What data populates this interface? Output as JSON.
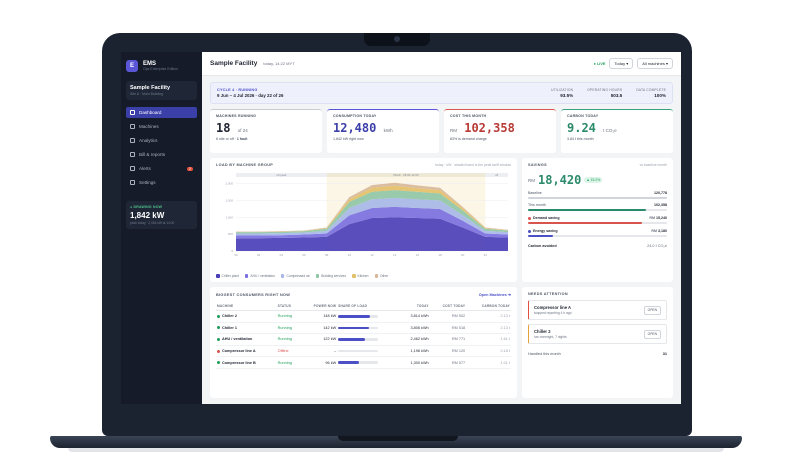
{
  "app": {
    "logo": "E",
    "name": "EMS",
    "subtitle": "Ops Enterprise Edition"
  },
  "facility": {
    "name": "Sample Facility",
    "sub": "Site A · Main Building"
  },
  "nav": [
    {
      "label": "Dashboard",
      "icon": "dashboard-icon"
    },
    {
      "label": "Machines",
      "icon": "machines-icon"
    },
    {
      "label": "Analytics",
      "icon": "analytics-icon"
    },
    {
      "label": "Bill & reports",
      "icon": "bill-icon"
    },
    {
      "label": "Alerts",
      "icon": "alert-icon",
      "badge": "2"
    },
    {
      "label": "Settings",
      "icon": "settings-icon"
    }
  ],
  "drawing_now": {
    "label": "● DRAWING NOW",
    "value": "1,842 kW",
    "sub": "peak today · 2,064 kW at 14:00"
  },
  "topbar": {
    "title": "Sample Facility",
    "subtitle": "today, 14:22 MYT",
    "live": "● LIVE",
    "range": "Today ▾",
    "filter": "All machines ▾"
  },
  "cycle": {
    "label": "CYCLE 4 · RUNNING",
    "dates": "9 Jun – 4 Jul 2026 · day 22 of 26",
    "stats": [
      {
        "k": "UTILIZATION",
        "v": "93.5%"
      },
      {
        "k": "OPERATING HOURS",
        "v": "503.5"
      },
      {
        "k": "DATA COMPLETE",
        "v": "100%"
      }
    ]
  },
  "kpis": {
    "running": {
      "label": "MACHINES RUNNING",
      "value": "18",
      "unit": "of 24",
      "sub_a": "6 idle or off ·",
      "sub_b": "1 fault"
    },
    "consumption": {
      "label": "CONSUMPTION TODAY",
      "value": "12,480",
      "unit": "kWh",
      "sub": "1,842 kW right now"
    },
    "cost": {
      "label": "COST THIS MONTH",
      "prefix": "RM",
      "value": "102,358",
      "sub": "83% is demand charge"
    },
    "carbon": {
      "label": "CARBON TODAY",
      "value": "9.24",
      "unit": "t CO₂e",
      "sub": "3.84 t this month"
    }
  },
  "chart_title": "LOAD BY MACHINE GROUP",
  "chart_subtitle": "today · kW · shaded band is the peak tariff window",
  "chart_data": {
    "type": "area",
    "title": "LOAD BY MACHINE GROUP",
    "x": [
      "00",
      "02",
      "04",
      "06",
      "08",
      "10",
      "12",
      "14",
      "16",
      "18",
      "20",
      "22"
    ],
    "ylabel": "kW",
    "y_ticks": [
      "0",
      "500",
      "1,000",
      "1,500",
      "2,000"
    ],
    "ylim": [
      0,
      2200
    ],
    "bands": [
      {
        "label": "off-peak",
        "from": 0,
        "to": 8
      },
      {
        "label": "PEAK · 08:00–22:00",
        "from": 8,
        "to": 22
      },
      {
        "label": "off",
        "from": 22,
        "to": 24
      }
    ],
    "series": [
      {
        "name": "Chiller plant",
        "color": "#4b3fb8",
        "values": [
          380,
          380,
          390,
          400,
          420,
          800,
          980,
          1000,
          980,
          960,
          700,
          420,
          400
        ]
      },
      {
        "name": "AHU / ventilation",
        "color": "#7b6fe0",
        "values": [
          80,
          80,
          80,
          90,
          100,
          260,
          300,
          310,
          300,
          290,
          200,
          100,
          90
        ]
      },
      {
        "name": "Compressed air",
        "color": "#a7b7e8",
        "values": [
          60,
          60,
          60,
          60,
          80,
          220,
          260,
          270,
          260,
          250,
          170,
          80,
          70
        ]
      },
      {
        "name": "Building services",
        "color": "#8fc6a6",
        "values": [
          40,
          40,
          40,
          40,
          60,
          180,
          220,
          230,
          220,
          210,
          140,
          60,
          50
        ]
      },
      {
        "name": "Kitchen",
        "color": "#e3c06a",
        "values": [
          10,
          10,
          10,
          10,
          20,
          80,
          120,
          130,
          110,
          100,
          60,
          20,
          10
        ]
      },
      {
        "name": "Other",
        "color": "#d8b89c",
        "values": [
          10,
          10,
          10,
          10,
          20,
          60,
          80,
          90,
          80,
          70,
          40,
          20,
          10
        ]
      }
    ]
  },
  "savings": {
    "title": "SAVINGS",
    "range": "vs baseline month",
    "prefix": "RM",
    "value": "18,420",
    "badge": "▲ 15.2%",
    "bars": [
      {
        "label": "Baseline",
        "value": "120,778",
        "pct": 100,
        "color": "#d1d5db"
      },
      {
        "label": "This month",
        "value": "102,358",
        "pct": 85,
        "color": "#2b8a6b"
      }
    ],
    "items": [
      {
        "label": "Demand saving",
        "value": "15,240",
        "pct": 82,
        "color": "#d9534f"
      },
      {
        "label": "Energy saving",
        "value": "3,180",
        "pct": 18,
        "color": "#4b50c7"
      }
    ],
    "carbon_label": "Carbon avoided",
    "carbon_value": "24.0 t CO₂e"
  },
  "consumers": {
    "title": "BIGGEST CONSUMERS RIGHT NOW",
    "link": "Open Machines ➜",
    "columns": [
      "MACHINE",
      "STATUS",
      "POWER NOW",
      "SHARE OF LOAD",
      "TODAY",
      "COST TODAY",
      "CARBON TODAY"
    ],
    "rows": [
      {
        "name": "Chiller 2",
        "status": "Running",
        "power": "148 kW",
        "share": 80,
        "today": "3,814 kWh",
        "cost": "RM  502",
        "carbon": "2.13 t"
      },
      {
        "name": "Chiller 1",
        "status": "Running",
        "power": "142 kW",
        "share": 77,
        "today": "3,806 kWh",
        "cost": "RM  518",
        "carbon": "2.13 t"
      },
      {
        "name": "AHU / ventilation",
        "status": "Running",
        "power": "122 kW",
        "share": 66,
        "today": "2,462 kWh",
        "cost": "RM  771",
        "carbon": "1.61 t"
      },
      {
        "name": "Compressor line A",
        "status": "Offline",
        "power": "–",
        "share": 0,
        "today": "1,196 kWh",
        "cost": "RM  120",
        "carbon": "0.18 t"
      },
      {
        "name": "Compressor line B",
        "status": "Running",
        "power": "96 kW",
        "share": 52,
        "today": "1,300 kWh",
        "cost": "RM  577",
        "carbon": "1.01 t"
      }
    ]
  },
  "attention": {
    "title": "NEEDS ATTENTION",
    "items": [
      {
        "name": "Compressor line A",
        "sub": "stopped reporting 4 h ago",
        "action": "OPEN"
      },
      {
        "name": "Chiller 2",
        "sub": "ran overnight, 7 nights",
        "action": "OPEN"
      }
    ],
    "handled_label": "Handled this month",
    "handled_value": "31"
  }
}
